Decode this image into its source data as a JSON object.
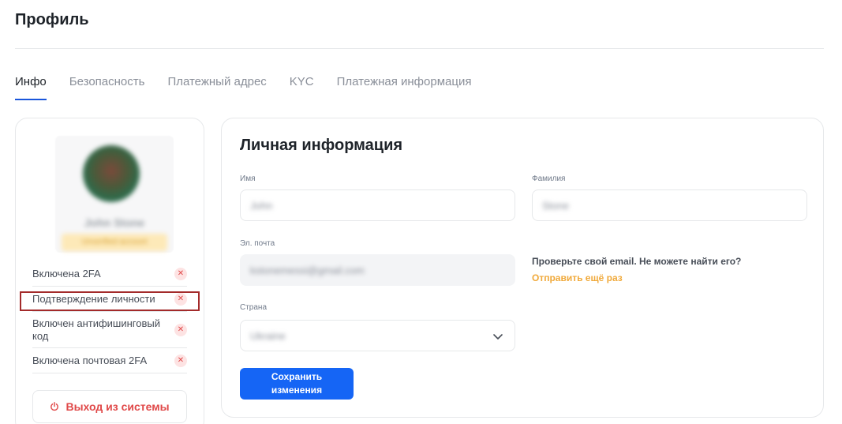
{
  "page": {
    "title": "Профиль"
  },
  "tabs": [
    {
      "label": "Инфо",
      "active": true
    },
    {
      "label": "Безопасность",
      "active": false
    },
    {
      "label": "Платежный адрес",
      "active": false
    },
    {
      "label": "KYC",
      "active": false
    },
    {
      "label": "Платежная информация",
      "active": false
    }
  ],
  "profile": {
    "name": "John Stone",
    "badge": "Unverified account"
  },
  "status_items": [
    {
      "label": "Включена 2FA",
      "icon": "x-icon"
    },
    {
      "label": "Подтверждение личности",
      "icon": "x-icon"
    },
    {
      "label": "Включен антифишинговый код",
      "icon": "x-icon"
    },
    {
      "label": "Включена почтовая 2FA",
      "icon": "x-icon"
    }
  ],
  "logout": {
    "label": "Выход из системы"
  },
  "personal": {
    "title": "Личная информация",
    "first_name_label": "Имя",
    "first_name_value": "John",
    "last_name_label": "Фамилия",
    "last_name_value": "Stone",
    "email_label": "Эл. почта",
    "email_value": "kstonemessi@gmail.com",
    "verify_note": "Проверьте свой email. Не можете найти его?",
    "resend_label": "Отправить ещё раз",
    "country_label": "Страна",
    "country_value": "Ukraine",
    "save_label_line1": "Сохранить",
    "save_label_line2": "изменения"
  },
  "colors": {
    "accent": "#1565f5",
    "tab_underline": "#1a56db",
    "danger": "#e04848",
    "warning": "#f0a93a",
    "highlight": "#a32a2a"
  }
}
